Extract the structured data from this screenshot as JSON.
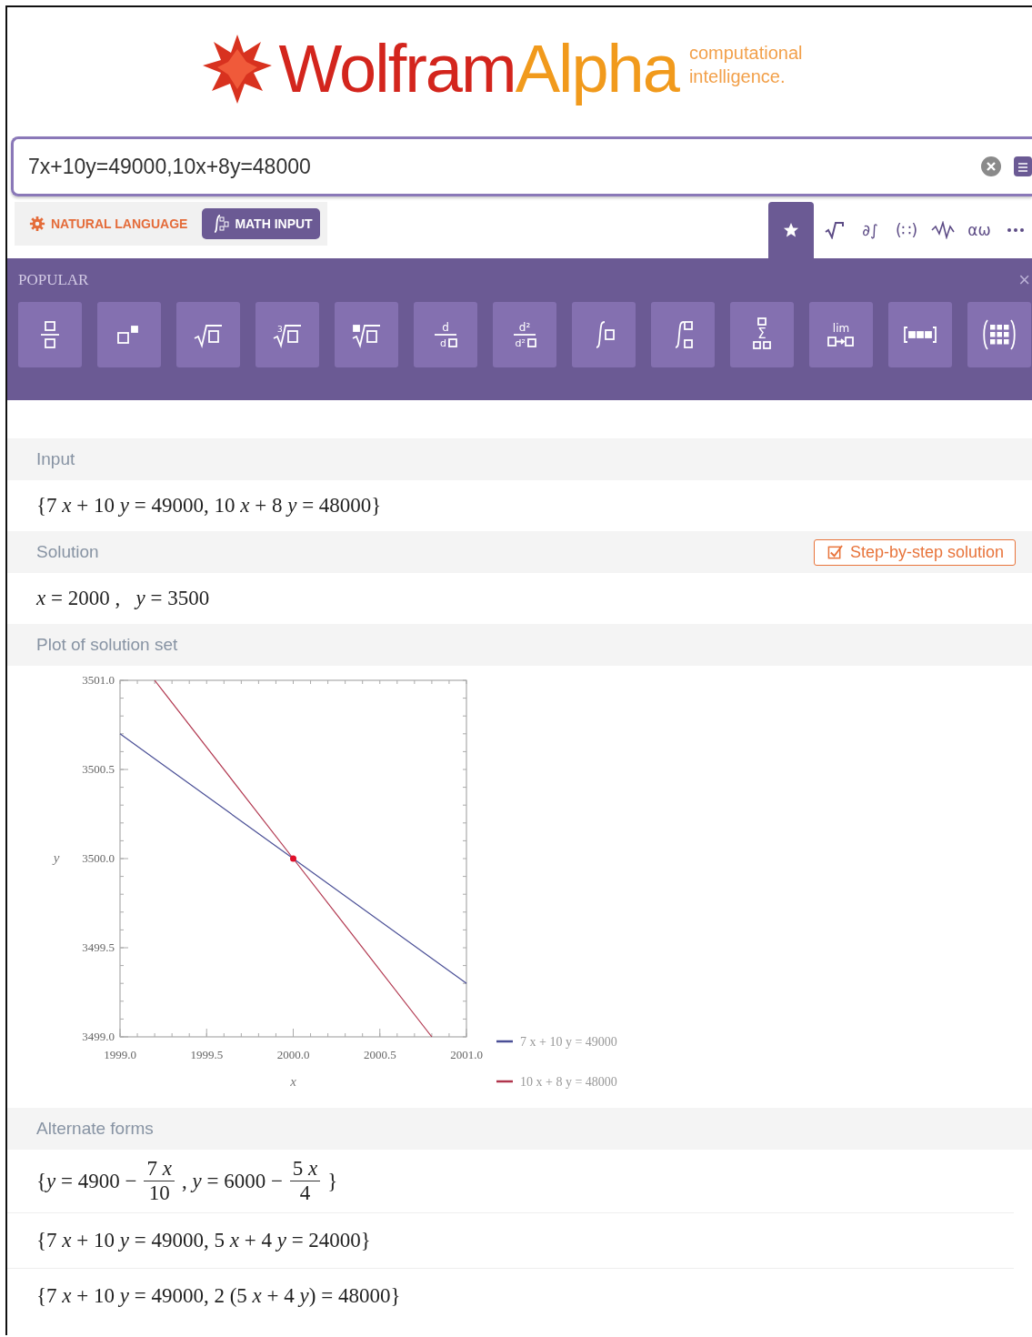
{
  "logo": {
    "name_first": "Wolfram",
    "name_second": "Alpha",
    "tagline": [
      "computational",
      "intelligence."
    ]
  },
  "search": {
    "value": "7x+10y=49000,10x+8y=48000"
  },
  "input_modes": [
    {
      "label": "NATURAL LANGUAGE",
      "kind": "natural",
      "selected": false
    },
    {
      "label": "MATH INPUT",
      "kind": "math",
      "selected": true
    }
  ],
  "palette_tabs": [
    {
      "kind": "star",
      "selected": true
    },
    {
      "kind": "root",
      "selected": false
    },
    {
      "kind": "symbol",
      "symbol": "∂∫",
      "selected": false
    },
    {
      "kind": "symbol",
      "symbol": "(∷)",
      "selected": false
    },
    {
      "kind": "wave",
      "selected": false
    },
    {
      "kind": "symbol",
      "symbol": "αω",
      "selected": false
    },
    {
      "kind": "more",
      "selected": false
    }
  ],
  "palette": {
    "title": "POPULAR",
    "close": "×",
    "buttons": [
      {
        "kind": "fraction"
      },
      {
        "kind": "power"
      },
      {
        "kind": "sqrt"
      },
      {
        "kind": "indexed_root",
        "symbol": "3"
      },
      {
        "kind": "nth_root"
      },
      {
        "kind": "derivative",
        "numerator": "d",
        "denominator": "d"
      },
      {
        "kind": "derivative",
        "numerator": "d²",
        "denominator": "d²"
      },
      {
        "kind": "integral"
      },
      {
        "kind": "definite_integral"
      },
      {
        "kind": "sum",
        "symbol": "Σ"
      },
      {
        "kind": "limit",
        "symbol": "lim"
      },
      {
        "kind": "vector"
      },
      {
        "kind": "matrix"
      }
    ]
  },
  "pods": [
    {
      "title": "Input",
      "kind": "text",
      "lines": [
        "{7 *x* + 10 *y* = 49000, 10 *x* + 8 *y* = 48000}"
      ]
    },
    {
      "title": "Solution",
      "kind": "text",
      "button": "Step-by-step solution",
      "lines": [
        "*x* = 2000 ,   *y* = 3500"
      ]
    },
    {
      "title": "Plot of solution set",
      "kind": "plot",
      "chart_data": {
        "type": "line",
        "xlabel": "x",
        "ylabel": "y",
        "x": [
          1999,
          1999.2,
          2000,
          2000.8,
          2001
        ],
        "series": [
          {
            "name": "7 x + 10 y = 49000",
            "color": "#4a4f96",
            "values": [
              3500.7,
              3500.56,
              3500,
              3499.44,
              3499.3
            ]
          },
          {
            "name": "10 x + 8 y = 48000",
            "color": "#b0344c",
            "values": [
              null,
              3501,
              3500,
              3499,
              null
            ]
          }
        ],
        "xlim": [
          1999,
          2001
        ],
        "ylim": [
          3499,
          3501
        ],
        "xticks": [
          {
            "value": 1999,
            "label": "1999.0"
          },
          {
            "value": 1999.5,
            "label": "1999.5"
          },
          {
            "value": 2000,
            "label": "2000.0"
          },
          {
            "value": 2000.5,
            "label": "2000.5"
          },
          {
            "value": 2001,
            "label": "2001.0"
          }
        ],
        "yticks": [
          {
            "value": 3499,
            "label": "3499.0"
          },
          {
            "value": 3499.5,
            "label": "3499.5"
          },
          {
            "value": 3500,
            "label": "3500.0"
          },
          {
            "value": 3500.5,
            "label": "3500.5"
          },
          {
            "value": 3501,
            "label": "3501.0"
          }
        ],
        "legend": true
      }
    },
    {
      "title": "Alternate forms",
      "kind": "forms",
      "forms": [
        {
          "kind": "fractions",
          "parts": [
            {
              "text": "{*y* = 4900 −"
            },
            {
              "numerator": "7 *x*",
              "denominator": "10"
            },
            {
              "text": ", *y* = 6000 −"
            },
            {
              "numerator": "5 *x*",
              "denominator": "4"
            },
            {
              "text": "}"
            }
          ]
        },
        {
          "kind": "text",
          "text": "{7 *x* + 10 *y* = 49000, 5 *x* + 4 *y* = 24000}"
        },
        {
          "kind": "text",
          "text": "{7 *x* + 10 *y* = 49000, 2 (5 *x* + 4 *y*) = 48000}"
        }
      ]
    }
  ]
}
